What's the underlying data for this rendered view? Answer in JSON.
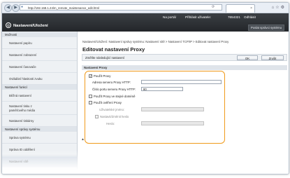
{
  "browser": {
    "address": "http://192.168.1.24/m_remote_maintenance_edit.html",
    "nav_back": "◀",
    "nav_forward": "▶",
    "tab_close": "×",
    "icons": [
      "home-icon",
      "star-icon",
      "gear-icon"
    ]
  },
  "header": {
    "portal_link": "Na portál",
    "user_label": "Přihlásit uživatele:",
    "user_id": "7654321",
    "logout": "Odhlásit",
    "title": "Nastavení/Uložení",
    "mail_button": "Poslat správci systému"
  },
  "sidebar": {
    "sections": [
      {
        "label": "Možnosti",
        "items": [
          "Nastavení papíru",
          "Nastavení zobrazení",
          "Nastavení časovače",
          "Ovládání hlasitosti zvuku"
        ]
      },
      {
        "label": "Nastavení funkcí",
        "items": [
          "Běžná nastavení",
          "Nastavení tisku z paměťového média",
          "Nastavení tiskárny"
        ]
      },
      {
        "label": "Nastavení správy systému",
        "items": [
          "Správa systému",
          "Správa ID oddělení",
          "Nastavení sítě",
          "Nastavení zabezpečení"
        ]
      }
    ],
    "active_item": "Nastavení sítě"
  },
  "main": {
    "breadcrumb": "Nastavení/Uložení: Nastavení správy systému: Nastavení sítě > Nastavení TCP/IP > Editovat nastavení Proxy",
    "title": "Editovat nastavení Proxy",
    "action_label": "Změňte následující nastavení",
    "ok_button": "OK",
    "cancel_button": "Zrušit",
    "section_header": "Nastavení Proxy",
    "use_proxy_label": "Použít Proxy",
    "use_proxy_checked": "✓",
    "address_label": "Adresa serveru Proxy HTTP:",
    "address_value": "",
    "port_label": "Číslo portu serveru Proxy HTTP:",
    "port_value": "80",
    "same_domain_label": "Použít Proxy ve stejné doméně",
    "auth_label": "Použít ověření Proxy",
    "username_label": "Uživatelské jméno:",
    "set_password_label": "Nastavit/Změnit heslo",
    "password_label": "Heslo:",
    "back_to_top": "▲"
  },
  "colors": {
    "header_bg": "#2e3236",
    "highlight": "#f09a1a",
    "sidebar_bg": "#eef1f4"
  }
}
